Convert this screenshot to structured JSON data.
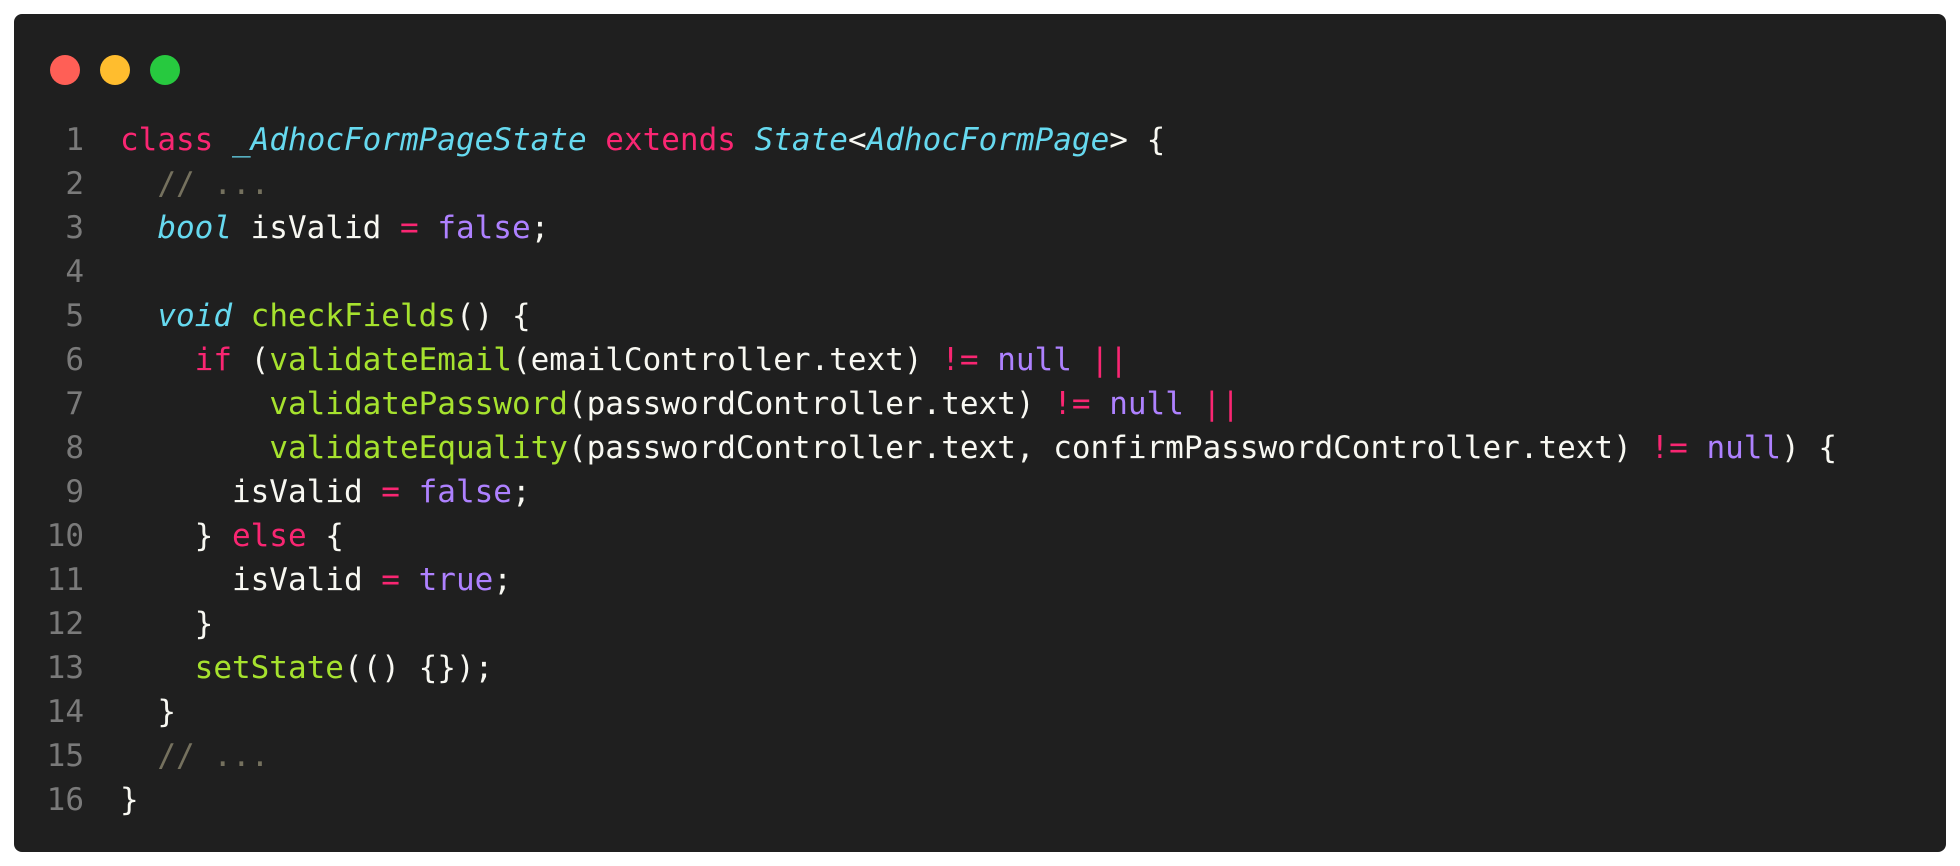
{
  "window": {
    "controls": [
      {
        "name": "close",
        "color": "#ff5f56"
      },
      {
        "name": "minimize",
        "color": "#ffbd2e"
      },
      {
        "name": "maximize",
        "color": "#27c93f"
      }
    ]
  },
  "code": {
    "lines": [
      {
        "number": "1",
        "tokens": [
          {
            "t": "class",
            "k": "keyword"
          },
          {
            "t": " ",
            "k": "plain"
          },
          {
            "t": "_AdhocFormPageState",
            "k": "type"
          },
          {
            "t": " ",
            "k": "plain"
          },
          {
            "t": "extends",
            "k": "keyword"
          },
          {
            "t": " ",
            "k": "plain"
          },
          {
            "t": "State",
            "k": "type"
          },
          {
            "t": "<",
            "k": "plain"
          },
          {
            "t": "AdhocFormPage",
            "k": "type"
          },
          {
            "t": "> {",
            "k": "plain"
          }
        ]
      },
      {
        "number": "2",
        "tokens": [
          {
            "t": "  ",
            "k": "plain"
          },
          {
            "t": "// ...",
            "k": "comment"
          }
        ]
      },
      {
        "number": "3",
        "tokens": [
          {
            "t": "  ",
            "k": "plain"
          },
          {
            "t": "bool",
            "k": "type"
          },
          {
            "t": " isValid ",
            "k": "plain"
          },
          {
            "t": "=",
            "k": "operator"
          },
          {
            "t": " ",
            "k": "plain"
          },
          {
            "t": "false",
            "k": "constant"
          },
          {
            "t": ";",
            "k": "plain"
          }
        ]
      },
      {
        "number": "4",
        "tokens": []
      },
      {
        "number": "5",
        "tokens": [
          {
            "t": "  ",
            "k": "plain"
          },
          {
            "t": "void",
            "k": "type"
          },
          {
            "t": " ",
            "k": "plain"
          },
          {
            "t": "checkFields",
            "k": "function"
          },
          {
            "t": "() {",
            "k": "plain"
          }
        ]
      },
      {
        "number": "6",
        "tokens": [
          {
            "t": "    ",
            "k": "plain"
          },
          {
            "t": "if",
            "k": "keyword"
          },
          {
            "t": " (",
            "k": "plain"
          },
          {
            "t": "validateEmail",
            "k": "function"
          },
          {
            "t": "(emailController.text) ",
            "k": "plain"
          },
          {
            "t": "!=",
            "k": "operator"
          },
          {
            "t": " ",
            "k": "plain"
          },
          {
            "t": "null",
            "k": "constant"
          },
          {
            "t": " ",
            "k": "plain"
          },
          {
            "t": "||",
            "k": "operator"
          }
        ]
      },
      {
        "number": "7",
        "tokens": [
          {
            "t": "        ",
            "k": "plain"
          },
          {
            "t": "validatePassword",
            "k": "function"
          },
          {
            "t": "(passwordController.text) ",
            "k": "plain"
          },
          {
            "t": "!=",
            "k": "operator"
          },
          {
            "t": " ",
            "k": "plain"
          },
          {
            "t": "null",
            "k": "constant"
          },
          {
            "t": " ",
            "k": "plain"
          },
          {
            "t": "||",
            "k": "operator"
          }
        ]
      },
      {
        "number": "8",
        "tokens": [
          {
            "t": "        ",
            "k": "plain"
          },
          {
            "t": "validateEquality",
            "k": "function"
          },
          {
            "t": "(passwordController.text, confirmPasswordController.text) ",
            "k": "plain"
          },
          {
            "t": "!=",
            "k": "operator"
          },
          {
            "t": " ",
            "k": "plain"
          },
          {
            "t": "null",
            "k": "constant"
          },
          {
            "t": ") {",
            "k": "plain"
          }
        ]
      },
      {
        "number": "9",
        "tokens": [
          {
            "t": "      isValid ",
            "k": "plain"
          },
          {
            "t": "=",
            "k": "operator"
          },
          {
            "t": " ",
            "k": "plain"
          },
          {
            "t": "false",
            "k": "constant"
          },
          {
            "t": ";",
            "k": "plain"
          }
        ]
      },
      {
        "number": "10",
        "tokens": [
          {
            "t": "    } ",
            "k": "plain"
          },
          {
            "t": "else",
            "k": "keyword"
          },
          {
            "t": " {",
            "k": "plain"
          }
        ]
      },
      {
        "number": "11",
        "tokens": [
          {
            "t": "      isValid ",
            "k": "plain"
          },
          {
            "t": "=",
            "k": "operator"
          },
          {
            "t": " ",
            "k": "plain"
          },
          {
            "t": "true",
            "k": "constant"
          },
          {
            "t": ";",
            "k": "plain"
          }
        ]
      },
      {
        "number": "12",
        "tokens": [
          {
            "t": "    }",
            "k": "plain"
          }
        ]
      },
      {
        "number": "13",
        "tokens": [
          {
            "t": "    ",
            "k": "plain"
          },
          {
            "t": "setState",
            "k": "function"
          },
          {
            "t": "(() {});",
            "k": "plain"
          }
        ]
      },
      {
        "number": "14",
        "tokens": [
          {
            "t": "  }",
            "k": "plain"
          }
        ]
      },
      {
        "number": "15",
        "tokens": [
          {
            "t": "  ",
            "k": "plain"
          },
          {
            "t": "// ...",
            "k": "comment"
          }
        ]
      },
      {
        "number": "16",
        "tokens": [
          {
            "t": "}",
            "k": "plain"
          }
        ]
      }
    ]
  }
}
